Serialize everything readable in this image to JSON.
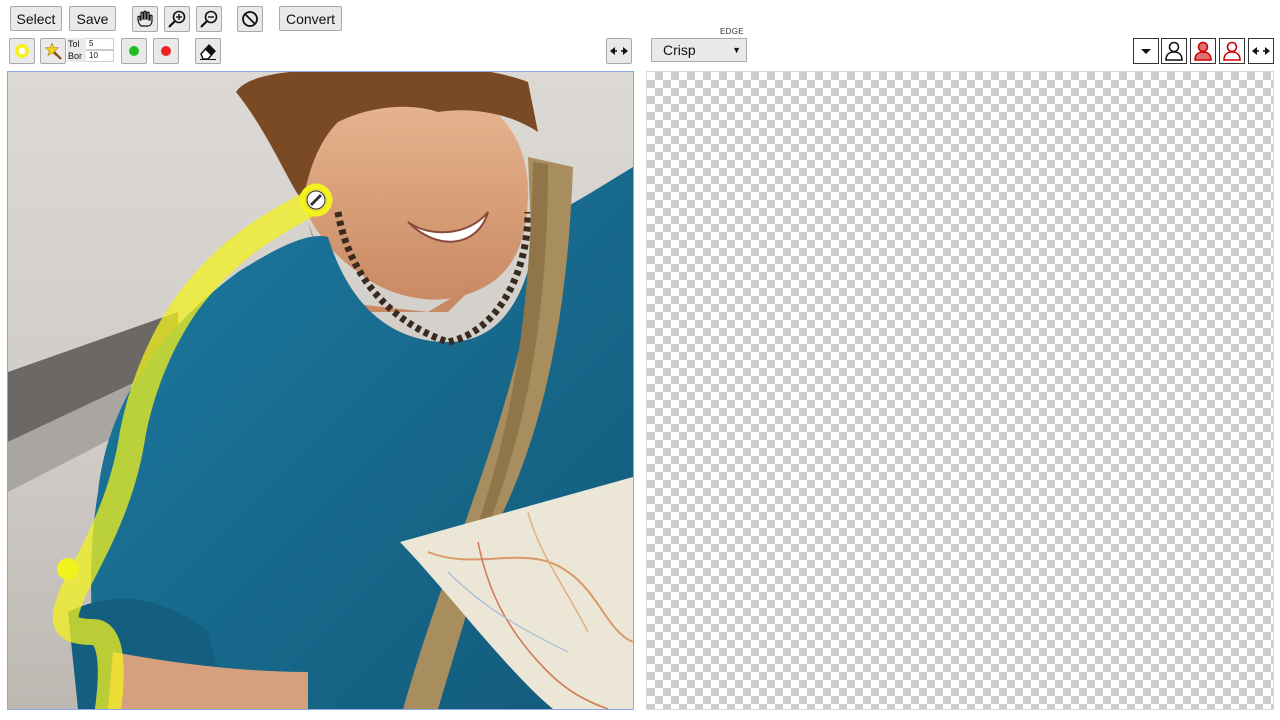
{
  "toolbar": {
    "select_label": "Select",
    "save_label": "Save",
    "convert_label": "Convert",
    "tol_label": "Tol",
    "tol_value": "5",
    "bor_label": "Bor",
    "bor_value": "10",
    "edge_label": "EDGE",
    "edge_selected": "Crisp"
  },
  "icons": {
    "pan": "hand-icon",
    "zoom_in": "zoom-in-icon",
    "zoom_out": "zoom-out-icon",
    "cancel": "cancel-icon",
    "highlighter": "highlighter-icon",
    "magic_wand": "magic-wand-icon",
    "keep": "green-dot-icon",
    "remove": "red-dot-icon",
    "eraser": "eraser-icon",
    "swap": "swap-arrows-icon"
  },
  "colors": {
    "highlight": "#f2f21e",
    "keep": "#22bb22",
    "remove": "#ee2222",
    "shirt": "#1a6f93",
    "strap": "#a88d5e"
  }
}
